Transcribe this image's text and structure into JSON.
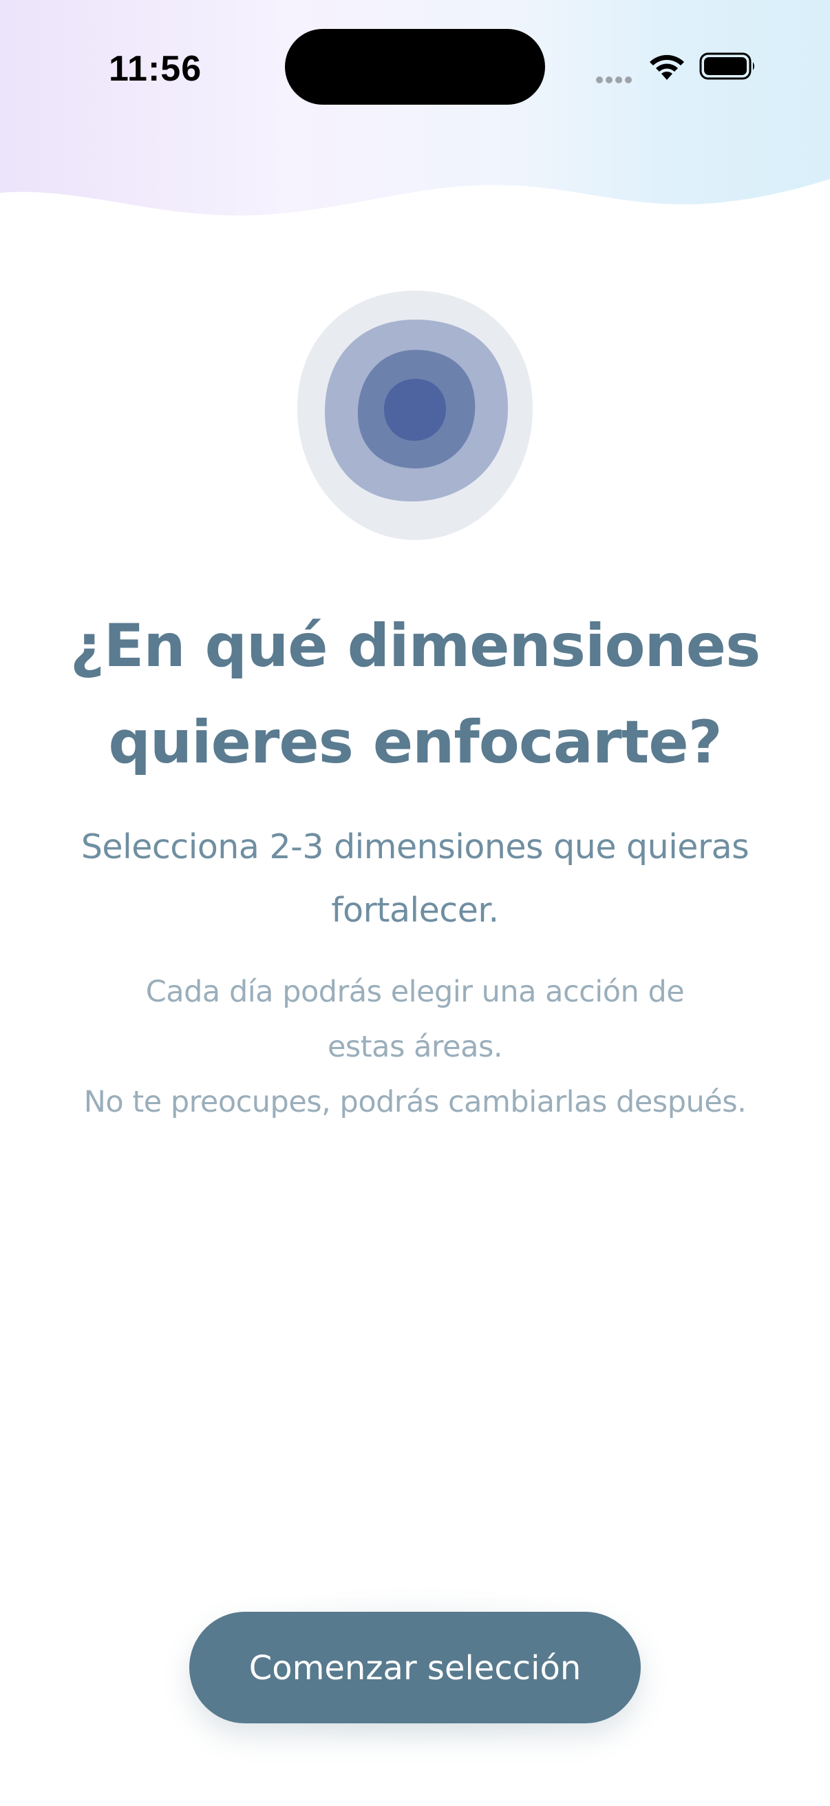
{
  "status_bar": {
    "time": "11:56",
    "icons": [
      "cellular-signal-icon",
      "wifi-icon",
      "battery-icon"
    ]
  },
  "hero": {
    "icon": "concentric-rings-illustration",
    "colors": [
      "#e8ebf0",
      "#a7b3cf",
      "#6d81ad",
      "#4e64a0"
    ]
  },
  "content": {
    "title_line1": "¿En qué dimensiones",
    "title_line2": "quieres enfocarte?",
    "subtitle_line1": "Selecciona 2-3 dimensiones que quieras",
    "subtitle_line2": "fortalecer.",
    "note_line1": "Cada día podrás elegir una acción de",
    "note_line2": "estas áreas.",
    "note_line3": "No te preocupes, podrás cambiarlas después."
  },
  "actions": {
    "start_label": "Comenzar selección"
  },
  "colors": {
    "primary": "#587a8e",
    "title": "#5a7b90",
    "subtitle": "#6f8ea1",
    "note": "#9aaebb"
  }
}
